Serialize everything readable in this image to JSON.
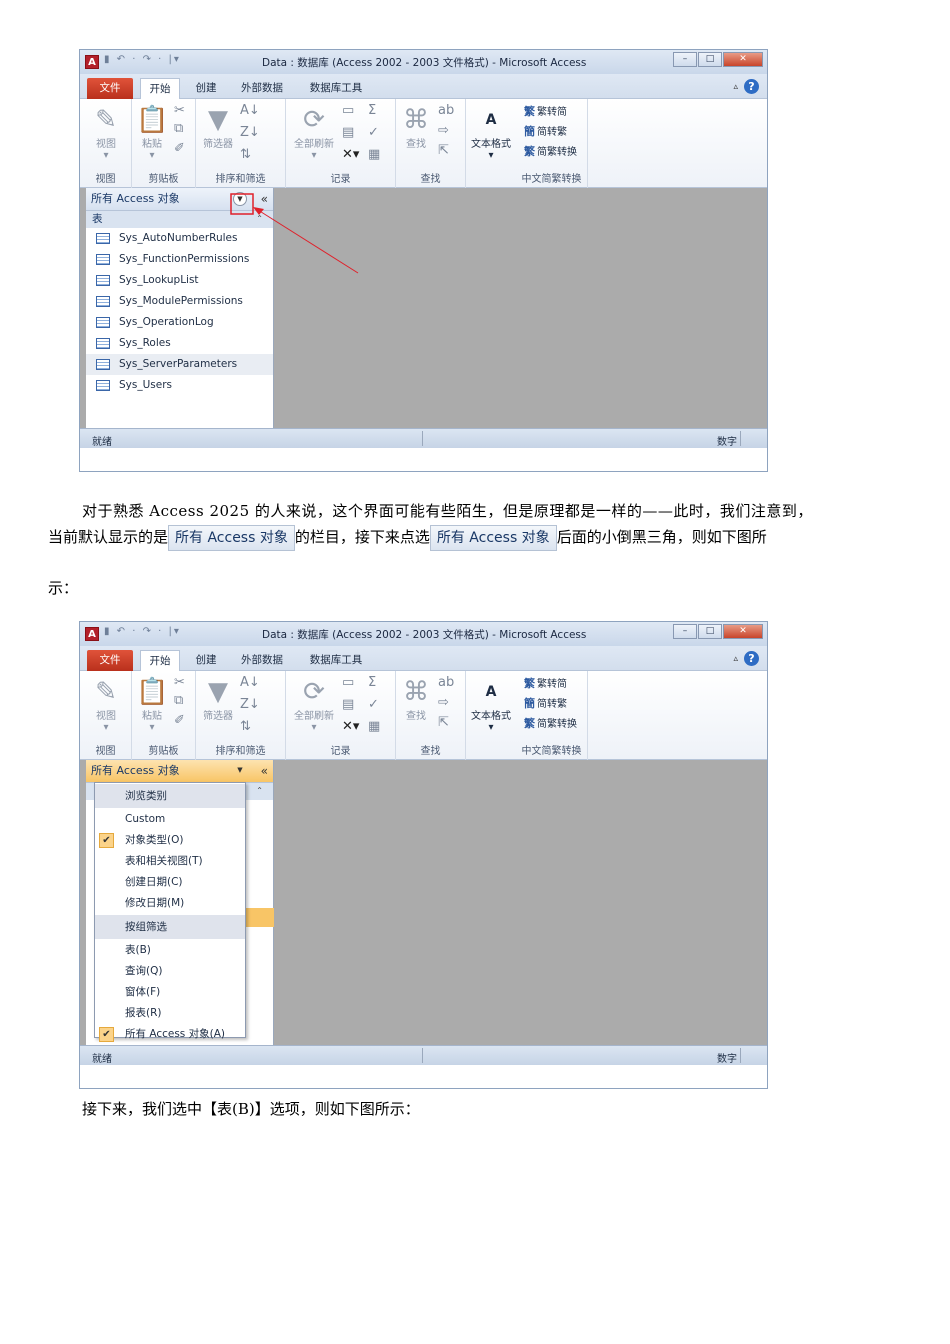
{
  "window": {
    "logo_letter": "A",
    "qat": "▮ ↶ · ↷ · |▾",
    "title": "Data : 数据库 (Access 2002 - 2003 文件格式) - Microsoft Access",
    "controls": {
      "minimize": "–",
      "maximize": "□",
      "close": "✕"
    }
  },
  "tabs": {
    "file": "文件",
    "home": "开始",
    "create": "创建",
    "external": "外部数据",
    "dbtools": "数据库工具",
    "help": "?"
  },
  "ribbon": {
    "view": {
      "label": "视图",
      "group": "视图"
    },
    "clipboard": {
      "paste": "粘贴",
      "group": "剪贴板"
    },
    "sort_filter": {
      "filter": "筛选器",
      "group": "排序和筛选"
    },
    "records": {
      "refresh": "全部刷新",
      "group": "记录"
    },
    "find": {
      "find": "查找",
      "group": "查找"
    },
    "text_format": {
      "label": "文本格式"
    },
    "chinese": {
      "t2s": "繁转简",
      "s2t": "简转繁",
      "convert": "简繁转换",
      "group": "中文简繁转换"
    }
  },
  "nav": {
    "header": "所有 Access 对象",
    "collapse": "«",
    "group": "表",
    "items": [
      "Sys_AutoNumberRules",
      "Sys_FunctionPermissions",
      "Sys_LookupList",
      "Sys_ModulePermissions",
      "Sys_OperationLog",
      "Sys_Roles",
      "Sys_ServerParameters",
      "Sys_Users"
    ]
  },
  "status": {
    "left": "就绪",
    "right": "数字"
  },
  "paragraph1": {
    "line1": "对于熟悉 Access 2025 的人来说，这个界面可能有些陌生，但是原理都是一样的——此时，我们注意到，",
    "line2_a": "当前默认显示的是",
    "chip": "所有 Access 对象",
    "line2_b": "的栏目，接下来点选",
    "line2_c": "后面的小倒黑三角，则如下图所",
    "line3": "示："
  },
  "menu": {
    "section1": "浏览类别",
    "items1": [
      "Custom",
      "对象类型(O)",
      "表和相关视图(T)",
      "创建日期(C)",
      "修改日期(M)"
    ],
    "section2": "按组筛选",
    "items2": [
      "表(B)",
      "查询(Q)",
      "窗体(F)",
      "报表(R)",
      "所有 Access 对象(A)"
    ],
    "checkmark": "✔"
  },
  "paragraph2": "接下来，我们选中【表(B)】选项，则如下图所示：",
  "colors": {
    "file_tab": "#c83a22",
    "annotation": "#e0202a",
    "workspace": "#ababab"
  }
}
